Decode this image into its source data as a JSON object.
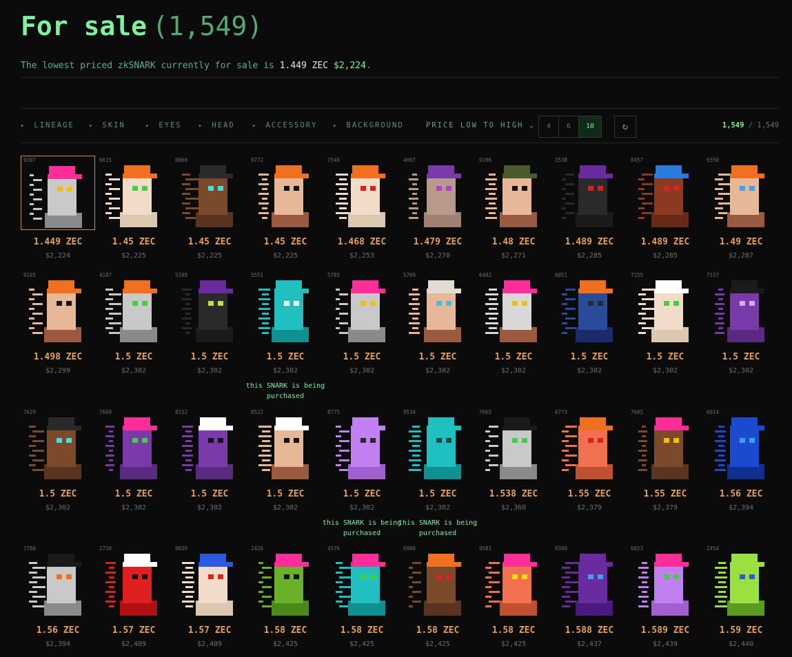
{
  "header": {
    "title": "For sale",
    "count": "(1,549)"
  },
  "subtitle": {
    "text": "The lowest priced zkSNARK currently for sale is ",
    "zec": "1.449 ZEC",
    "usd": "$2,224",
    "end": "."
  },
  "filters": [
    "LINEAGE",
    "SKIN",
    "EYES",
    "HEAD",
    "ACCESSORY",
    "BACKGROUND"
  ],
  "sort": {
    "label": "PRICE LOW TO HIGH"
  },
  "columns": [
    "4",
    "6",
    "10"
  ],
  "result": {
    "shown": "1,549",
    "sep": " / ",
    "total": "1,549"
  },
  "icons": {
    "filter_arrow": "caret-right-icon",
    "sort": "chevron-down-icon",
    "refresh": "refresh-icon"
  },
  "colors": {
    "accent": "#7ef0a0",
    "price": "#e6a05a",
    "background": "#0b0b0b"
  },
  "cards": [
    {
      "id": "9307",
      "price": "1.449 ZEC",
      "usd": "$2,224",
      "note": "",
      "hat": "#ff2d9a",
      "skin": "#c9c9c9",
      "eye": "#f5c000",
      "body": "#8a8a8a"
    },
    {
      "id": "6615",
      "price": "1.45 ZEC",
      "usd": "$2,225",
      "note": "",
      "hat": "#f07020",
      "skin": "#f0dcc8",
      "eye": "#40d040",
      "body": "#dcc8b0"
    },
    {
      "id": "8068",
      "price": "1.45 ZEC",
      "usd": "$2,225",
      "note": "",
      "hat": "#2a2a2a",
      "skin": "#7a4a2a",
      "eye": "#40e0e0",
      "body": "#5a3420"
    },
    {
      "id": "9772",
      "price": "1.45 ZEC",
      "usd": "$2,225",
      "note": "",
      "hat": "#f07020",
      "skin": "#e6b898",
      "eye": "#111111",
      "body": "#9a5a40"
    },
    {
      "id": "7548",
      "price": "1.468 ZEC",
      "usd": "$2,253",
      "note": "",
      "hat": "#f07020",
      "skin": "#f0dcc8",
      "eye": "#e02020",
      "body": "#dcc8b0"
    },
    {
      "id": "4067",
      "price": "1.479 ZEC",
      "usd": "$2,270",
      "note": "",
      "hat": "#7a3aaa",
      "skin": "#b89a8a",
      "eye": "#b040d0",
      "body": "#a08070"
    },
    {
      "id": "9106",
      "price": "1.48 ZEC",
      "usd": "$2,271",
      "note": "",
      "hat": "#4a5a2a",
      "skin": "#e6b898",
      "eye": "#111111",
      "body": "#9a5a40"
    },
    {
      "id": "3538",
      "price": "1.489 ZEC",
      "usd": "$2,285",
      "note": "",
      "hat": "#6a2aa0",
      "skin": "#2a2a2a",
      "eye": "#e02020",
      "body": "#1a1a1a"
    },
    {
      "id": "8457",
      "price": "1.489 ZEC",
      "usd": "$2,285",
      "note": "",
      "hat": "#2a7ae0",
      "skin": "#8a3a20",
      "eye": "#e02020",
      "body": "#6a2a18"
    },
    {
      "id": "6550",
      "price": "1.49 ZEC",
      "usd": "$2,287",
      "note": "",
      "hat": "#f07020",
      "skin": "#e6b898",
      "eye": "#40a0f0",
      "body": "#9a5a40"
    },
    {
      "id": "9265",
      "price": "1.498 ZEC",
      "usd": "$2,299",
      "note": "",
      "hat": "#f07020",
      "skin": "#e6b898",
      "eye": "#111111",
      "body": "#9a5a40"
    },
    {
      "id": "4187",
      "price": "1.5 ZEC",
      "usd": "$2,302",
      "note": "",
      "hat": "#f07020",
      "skin": "#c9c9c9",
      "eye": "#40d040",
      "body": "#8a8a8a"
    },
    {
      "id": "5198",
      "price": "1.5 ZEC",
      "usd": "$2,302",
      "note": "",
      "hat": "#6a2aa0",
      "skin": "#2a2a2a",
      "eye": "#c0e040",
      "body": "#1a1a1a"
    },
    {
      "id": "5551",
      "price": "1.5 ZEC",
      "usd": "$2,302",
      "note": "this SNARK is being purchased",
      "hat": "#20c0c0",
      "skin": "#20c0c0",
      "eye": "#ffffff",
      "body": "#109090"
    },
    {
      "id": "5705",
      "price": "1.5 ZEC",
      "usd": "$2,302",
      "note": "",
      "hat": "#ff2d9a",
      "skin": "#c9c9c9",
      "eye": "#f5c000",
      "body": "#8a8a8a"
    },
    {
      "id": "5769",
      "price": "1.5 ZEC",
      "usd": "$2,302",
      "note": "",
      "hat": "#e0dcd0",
      "skin": "#e6b898",
      "eye": "#40c0e0",
      "body": "#9a5a40"
    },
    {
      "id": "6402",
      "price": "1.5 ZEC",
      "usd": "$2,302",
      "note": "",
      "hat": "#ff2d9a",
      "skin": "#d8d8d8",
      "eye": "#f5c000",
      "body": "#9a5a40"
    },
    {
      "id": "6851",
      "price": "1.5 ZEC",
      "usd": "$2,302",
      "note": "",
      "hat": "#f07020",
      "skin": "#2a4a9a",
      "eye": "#2a2a2a",
      "body": "#1a2a6a"
    },
    {
      "id": "7155",
      "price": "1.5 ZEC",
      "usd": "$2,302",
      "note": "",
      "hat": "#ffffff",
      "skin": "#f0dcc8",
      "eye": "#40d040",
      "body": "#dcc8b0"
    },
    {
      "id": "7337",
      "price": "1.5 ZEC",
      "usd": "$2,302",
      "note": "",
      "hat": "#1a1a1a",
      "skin": "#7a3aaa",
      "eye": "#d0b0f0",
      "body": "#5a2a80"
    },
    {
      "id": "7629",
      "price": "1.5 ZEC",
      "usd": "$2,302",
      "note": "",
      "hat": "#2a2a2a",
      "skin": "#7a4a2a",
      "eye": "#40e0e0",
      "body": "#5a3420"
    },
    {
      "id": "7669",
      "price": "1.5 ZEC",
      "usd": "$2,302",
      "note": "",
      "hat": "#ff2d9a",
      "skin": "#7a3aaa",
      "eye": "#40d040",
      "body": "#5a2a80"
    },
    {
      "id": "8152",
      "price": "1.5 ZEC",
      "usd": "$2,302",
      "note": "",
      "hat": "#ffffff",
      "skin": "#7a3aaa",
      "eye": "#111111",
      "body": "#5a2a80"
    },
    {
      "id": "8522",
      "price": "1.5 ZEC",
      "usd": "$2,302",
      "note": "",
      "hat": "#ffffff",
      "skin": "#e6b898",
      "eye": "#111111",
      "body": "#9a5a40"
    },
    {
      "id": "8775",
      "price": "1.5 ZEC",
      "usd": "$2,302",
      "note": "this SNARK is being purchased",
      "hat": "#c080f0",
      "skin": "#c080f0",
      "eye": "#2a2a2a",
      "body": "#a060d0"
    },
    {
      "id": "9534",
      "price": "1.5 ZEC",
      "usd": "$2,302",
      "note": "this SNARK is being purchased",
      "hat": "#20c0c0",
      "skin": "#20c0c0",
      "eye": "#0a4a4a",
      "body": "#109090"
    },
    {
      "id": "7665",
      "price": "1.538 ZEC",
      "usd": "$2,360",
      "note": "",
      "hat": "#1a1a1a",
      "skin": "#c9c9c9",
      "eye": "#40d040",
      "body": "#8a8a8a"
    },
    {
      "id": "6773",
      "price": "1.55 ZEC",
      "usd": "$2,379",
      "note": "",
      "hat": "#f07020",
      "skin": "#f07050",
      "eye": "#e02020",
      "body": "#c05030"
    },
    {
      "id": "7605",
      "price": "1.55 ZEC",
      "usd": "$2,379",
      "note": "",
      "hat": "#ff2d9a",
      "skin": "#7a4a2a",
      "eye": "#f5c000",
      "body": "#5a3420"
    },
    {
      "id": "6014",
      "price": "1.56 ZEC",
      "usd": "$2,394",
      "note": "",
      "hat": "#1a4ad0",
      "skin": "#1a4ad0",
      "eye": "#40a0f0",
      "body": "#103090"
    },
    {
      "id": "7780",
      "price": "1.56 ZEC",
      "usd": "$2,394",
      "note": "",
      "hat": "#1a1a1a",
      "skin": "#c9c9c9",
      "eye": "#f07020",
      "body": "#8a8a8a"
    },
    {
      "id": "2730",
      "price": "1.57 ZEC",
      "usd": "$2,409",
      "note": "",
      "hat": "#ffffff",
      "skin": "#e02020",
      "eye": "#111111",
      "body": "#b01010"
    },
    {
      "id": "9039",
      "price": "1.57 ZEC",
      "usd": "$2,409",
      "note": "",
      "hat": "#2a5ae0",
      "skin": "#f0dcc8",
      "eye": "#e02020",
      "body": "#dcc8b0"
    },
    {
      "id": "2426",
      "price": "1.58 ZEC",
      "usd": "$2,425",
      "note": "",
      "hat": "#ff2d9a",
      "skin": "#6ab02a",
      "eye": "#111111",
      "body": "#4a8a1a"
    },
    {
      "id": "4576",
      "price": "1.58 ZEC",
      "usd": "$2,425",
      "note": "",
      "hat": "#ff2d9a",
      "skin": "#20c0c0",
      "eye": "#40d040",
      "body": "#109090"
    },
    {
      "id": "6988",
      "price": "1.58 ZEC",
      "usd": "$2,425",
      "note": "",
      "hat": "#f07020",
      "skin": "#7a4a2a",
      "eye": "#e02020",
      "body": "#5a3420"
    },
    {
      "id": "9581",
      "price": "1.58 ZEC",
      "usd": "$2,425",
      "note": "",
      "hat": "#ff2d9a",
      "skin": "#f07050",
      "eye": "#f5e000",
      "body": "#c05030"
    },
    {
      "id": "9380",
      "price": "1.588 ZEC",
      "usd": "$2,437",
      "note": "",
      "hat": "#6a2aa0",
      "skin": "#6a2aa0",
      "eye": "#40a0f0",
      "body": "#4a1a80"
    },
    {
      "id": "6023",
      "price": "1.589 ZEC",
      "usd": "$2,439",
      "note": "",
      "hat": "#ff2d9a",
      "skin": "#c080f0",
      "eye": "#40d040",
      "body": "#a060d0"
    },
    {
      "id": "2454",
      "price": "1.59 ZEC",
      "usd": "$2,440",
      "note": "",
      "hat": "#9ae040",
      "skin": "#9ae040",
      "eye": "#2a5ae0",
      "body": "#5a9a20"
    }
  ]
}
